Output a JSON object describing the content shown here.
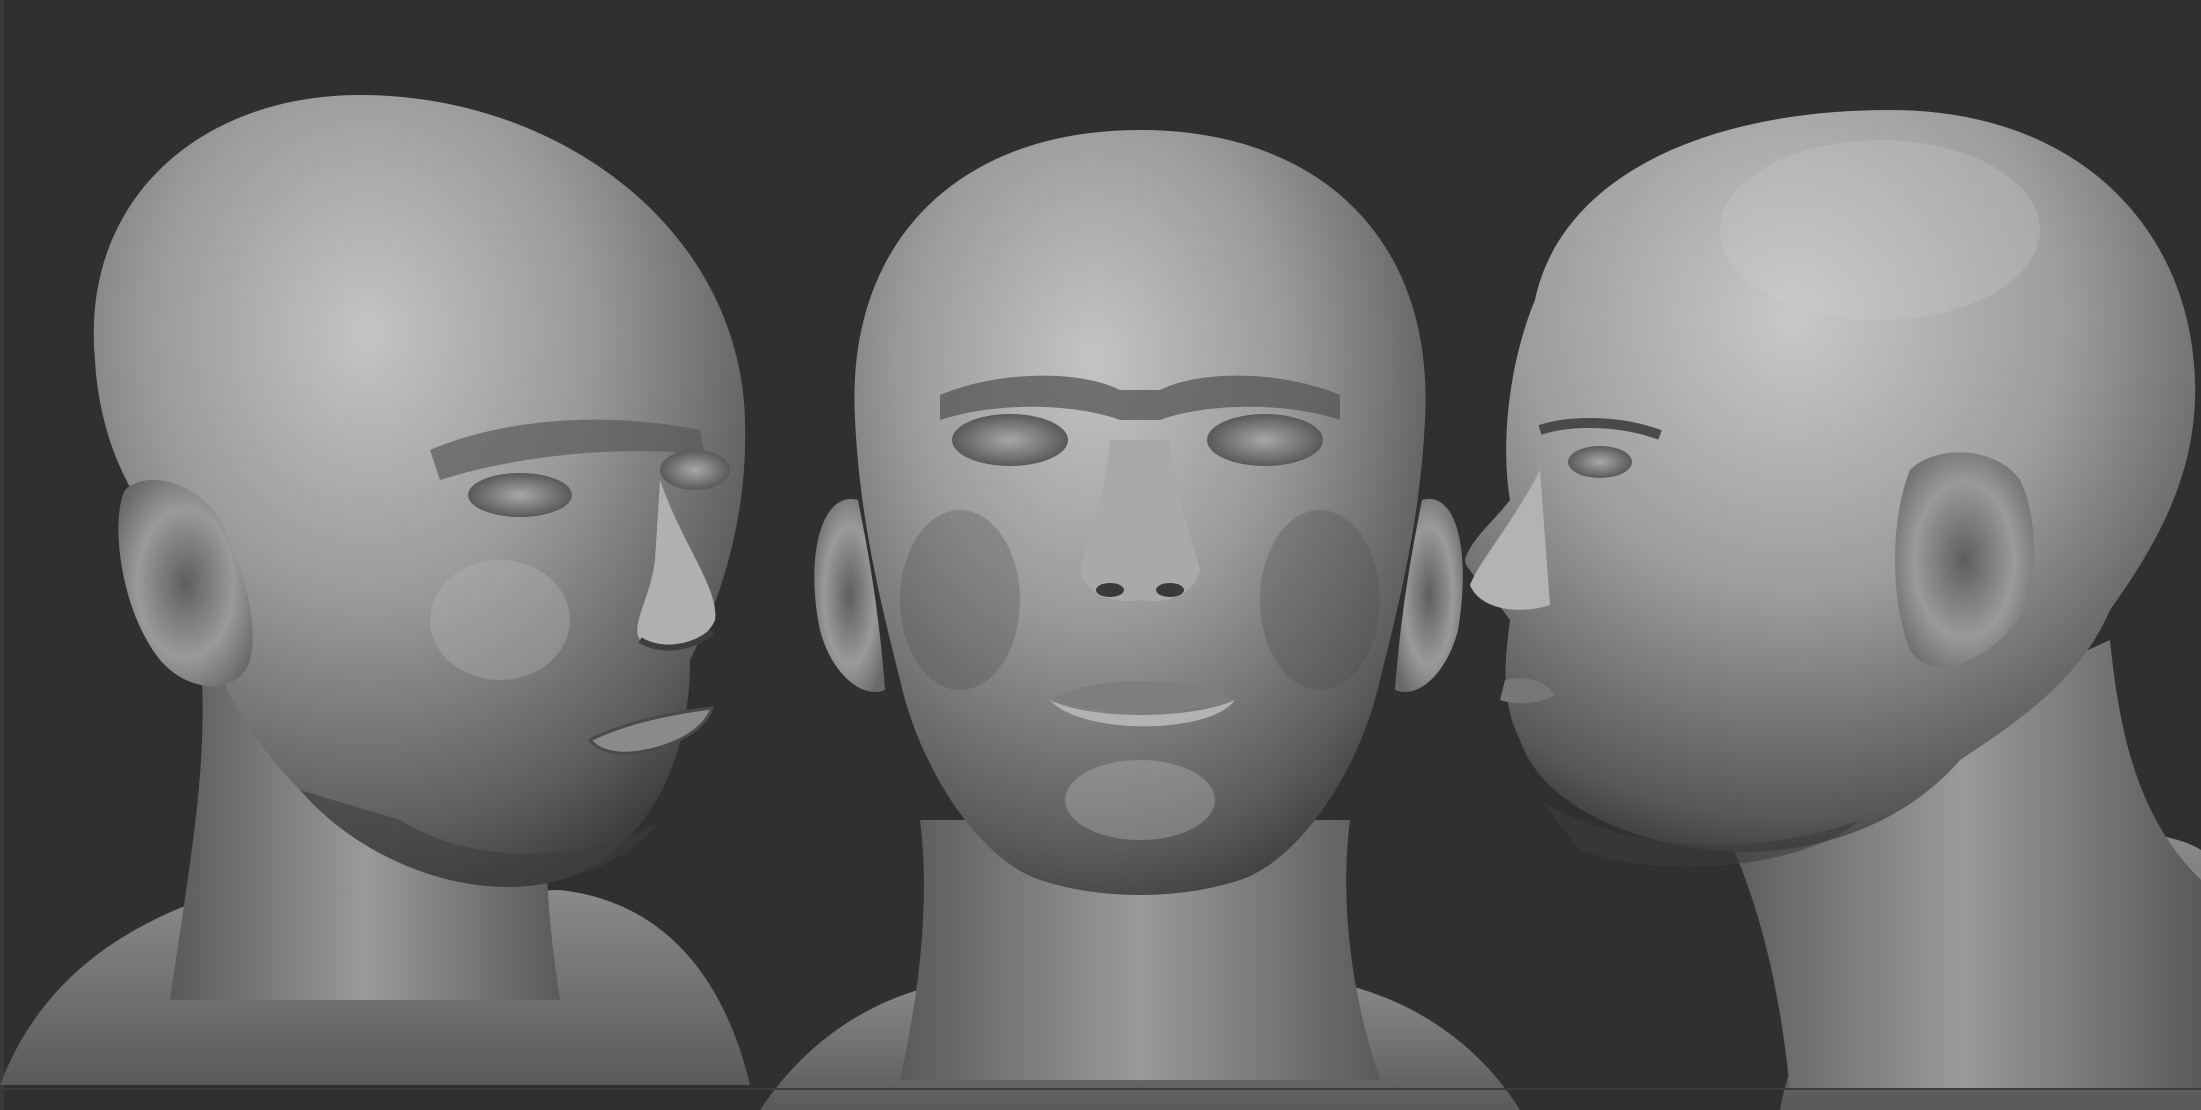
{
  "scene": {
    "background_color": "#303030",
    "clay_color": "#8c8c8c",
    "views": [
      {
        "name": "three-quarter-view"
      },
      {
        "name": "front-view"
      },
      {
        "name": "side-profile-view"
      }
    ]
  }
}
